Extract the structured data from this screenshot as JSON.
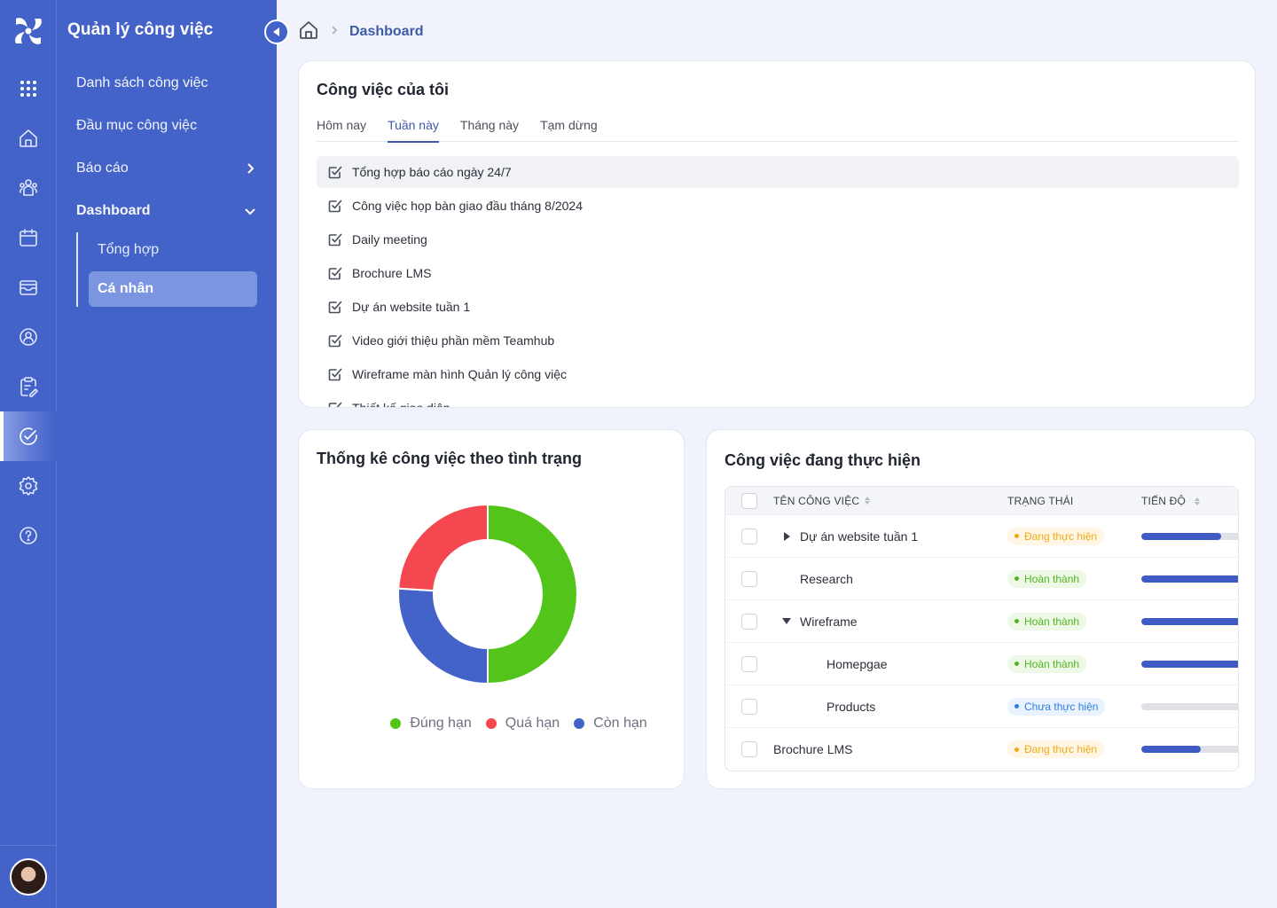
{
  "app": {
    "title": "Quản lý công việc"
  },
  "rail": {
    "items": [
      {
        "icon": "apps-grid-icon"
      },
      {
        "icon": "home-icon"
      },
      {
        "icon": "users-icon"
      },
      {
        "icon": "calendar-icon"
      },
      {
        "icon": "inbox-icon"
      },
      {
        "icon": "user-circle-icon"
      },
      {
        "icon": "clipboard-edit-icon"
      },
      {
        "icon": "check-circle-icon",
        "active": true
      },
      {
        "icon": "gear-icon"
      },
      {
        "icon": "help-icon"
      }
    ]
  },
  "nav": {
    "items": [
      {
        "label": "Danh sách công việc"
      },
      {
        "label": "Đầu mục công việc"
      },
      {
        "label": "Báo cáo",
        "chevron": "right"
      },
      {
        "label": "Dashboard",
        "chevron": "down",
        "expanded": true
      }
    ],
    "sub_items": [
      {
        "label": "Tổng hợp"
      },
      {
        "label": "Cá nhân",
        "active": true
      }
    ]
  },
  "breadcrumb": {
    "current": "Dashboard"
  },
  "my_tasks": {
    "title": "Công việc của tôi",
    "tabs": [
      "Hôm nay",
      "Tuần này",
      "Tháng này",
      "Tạm dừng"
    ],
    "active_tab": "Tuần này",
    "items": [
      "Tổng hợp báo cáo ngày 24/7",
      "Công việc họp bàn giao đầu tháng 8/2024",
      "Daily meeting",
      "Brochure LMS",
      "Dự án website tuần 1",
      "Video giới thiệu phần mềm Teamhub",
      "Wireframe màn hình Quản lý công việc",
      "Thiết kế giao diện"
    ]
  },
  "stats": {
    "title": "Thống kê công việc theo tình trạng"
  },
  "chart_data": {
    "type": "pie",
    "variant": "donut",
    "title": "Thống kê công việc theo tình trạng",
    "categories": [
      "Đúng hạn",
      "Còn hạn",
      "Quá hạn"
    ],
    "values": [
      50,
      26,
      24
    ],
    "colors": [
      "#52c41a",
      "#4463c8",
      "#f5474f"
    ],
    "legend_order": [
      "Đúng hạn",
      "Quá hạn",
      "Còn hạn"
    ],
    "legend_position": "bottom"
  },
  "in_progress": {
    "title": "Công việc đang thực hiện",
    "columns": {
      "name": "TÊN CÔNG VIỆC",
      "status": "TRẠNG THÁI",
      "progress": "TIẾN ĐỘ"
    },
    "rows": [
      {
        "name": "Dự án website tuần 1",
        "level": 0,
        "expander": "collapsed",
        "status": "Đang thực hiện",
        "status_type": "doing",
        "progress": 0.5
      },
      {
        "name": "Research",
        "level": 1,
        "expander": "",
        "status": "Hoàn thành",
        "status_type": "done",
        "progress": 1.0
      },
      {
        "name": "Wireframe",
        "level": 1,
        "expander": "expanded",
        "status": "Hoàn thành",
        "status_type": "done",
        "progress": 1.0
      },
      {
        "name": "Homepgae",
        "level": 2,
        "expander": "",
        "status": "Hoàn thành",
        "status_type": "done",
        "progress": 1.0
      },
      {
        "name": "Products",
        "level": 2,
        "expander": "",
        "status": "Chưa thực hiện",
        "status_type": "todo",
        "progress": 0.0
      },
      {
        "name": "Brochure LMS",
        "level": 0,
        "expander": "",
        "status": "Đang thực hiện",
        "status_type": "doing",
        "progress": 0.37
      }
    ],
    "status_colors": {
      "doing": {
        "bg": "#fff6e6",
        "fg": "#f0a818"
      },
      "done": {
        "bg": "#edf9e6",
        "fg": "#52b51f"
      },
      "todo": {
        "bg": "#eaf2ff",
        "fg": "#2f7fe0"
      }
    }
  }
}
